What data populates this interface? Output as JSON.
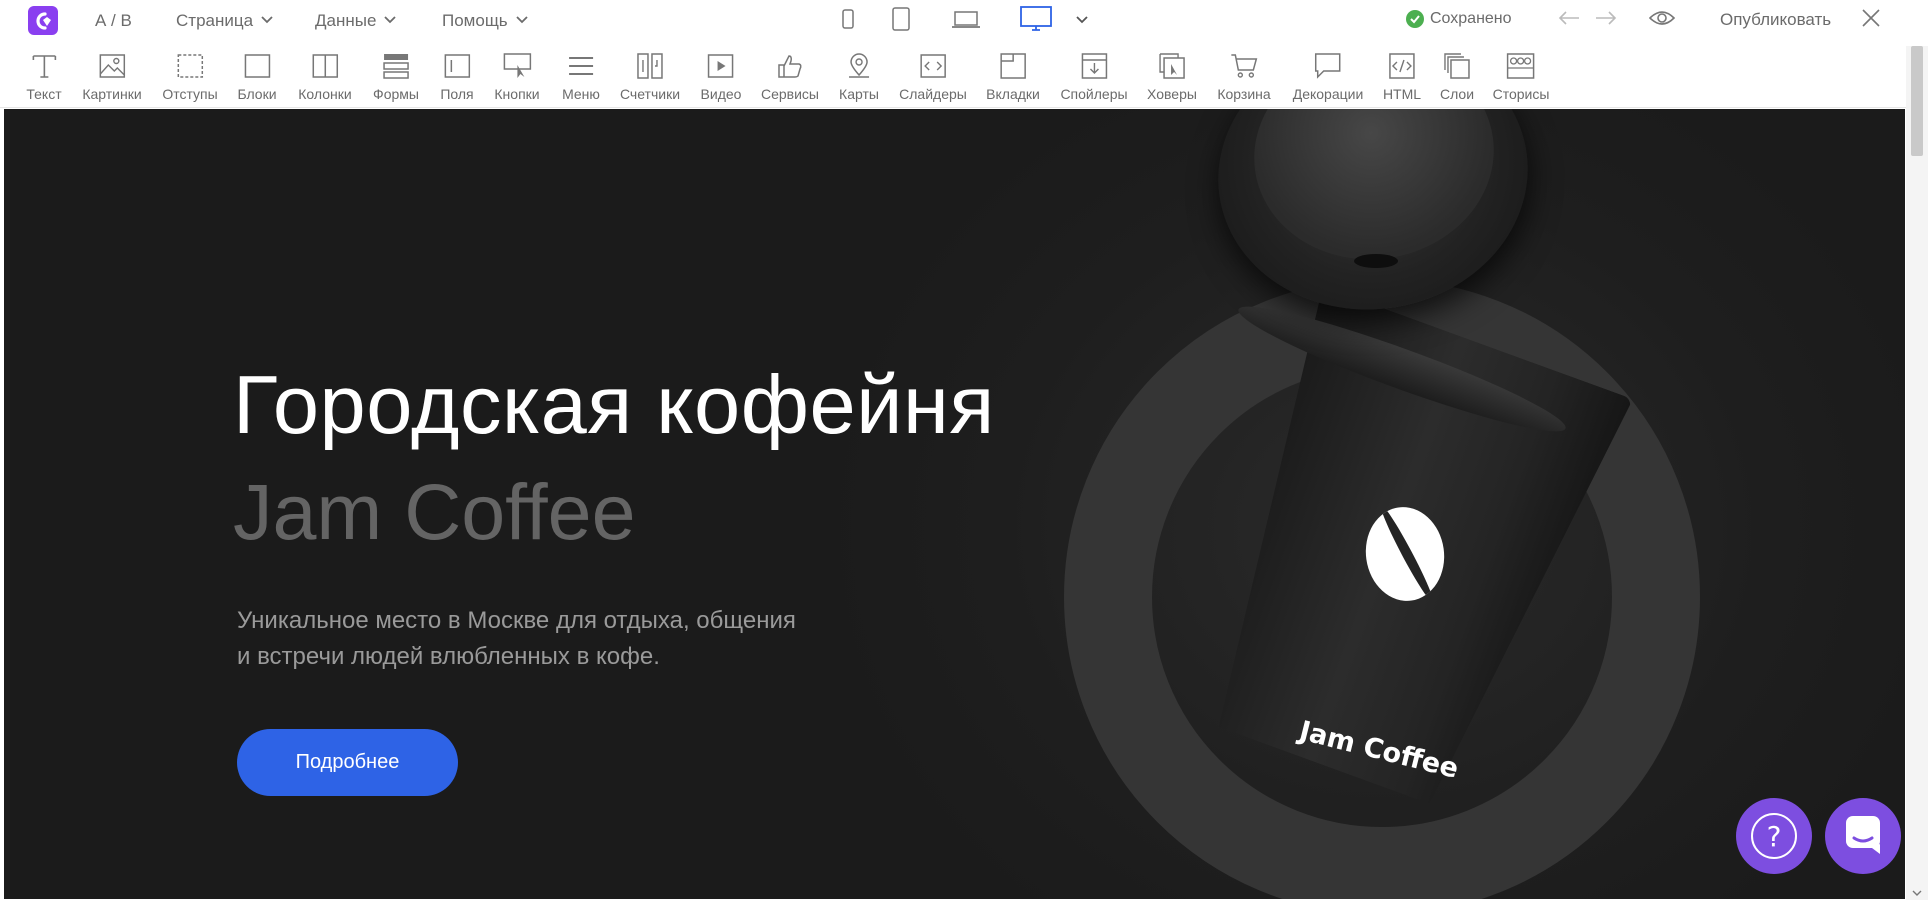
{
  "topbar": {
    "ab_label": "А / В",
    "menus": [
      {
        "label": "Страница"
      },
      {
        "label": "Данные"
      },
      {
        "label": "Помощь"
      }
    ],
    "devices": [
      "mobile-icon",
      "tablet-icon",
      "laptop-icon",
      "desktop-icon"
    ],
    "active_device": "desktop-icon",
    "saved_label": "Сохранено",
    "publish_label": "Опубликовать"
  },
  "toolbar": {
    "items": [
      {
        "label": "Текст",
        "icon": "text-icon"
      },
      {
        "label": "Картинки",
        "icon": "image-icon"
      },
      {
        "label": "Отступы",
        "icon": "spacing-icon"
      },
      {
        "label": "Блоки",
        "icon": "block-icon"
      },
      {
        "label": "Колонки",
        "icon": "columns-icon"
      },
      {
        "label": "Формы",
        "icon": "forms-icon"
      },
      {
        "label": "Поля",
        "icon": "fields-icon"
      },
      {
        "label": "Кнопки",
        "icon": "button-icon"
      },
      {
        "label": "Меню",
        "icon": "menu-icon"
      },
      {
        "label": "Счетчики",
        "icon": "counters-icon"
      },
      {
        "label": "Видео",
        "icon": "video-icon"
      },
      {
        "label": "Сервисы",
        "icon": "services-icon"
      },
      {
        "label": "Карты",
        "icon": "map-pin-icon"
      },
      {
        "label": "Слайдеры",
        "icon": "slider-icon"
      },
      {
        "label": "Вкладки",
        "icon": "tabs-icon"
      },
      {
        "label": "Спойлеры",
        "icon": "spoiler-icon"
      },
      {
        "label": "Ховеры",
        "icon": "hover-icon"
      },
      {
        "label": "Корзина",
        "icon": "cart-icon"
      },
      {
        "label": "Декорации",
        "icon": "decor-icon"
      },
      {
        "label": "HTML",
        "icon": "html-icon"
      },
      {
        "label": "Слои",
        "icon": "layers-icon"
      },
      {
        "label": "Сторисы",
        "icon": "stories-icon"
      }
    ]
  },
  "hero": {
    "title": "Городская кофейня",
    "subtitle": "Jam Coffee",
    "lead_line1": "Уникальное место в Москве для отдыха, общения",
    "lead_line2": "и встречи людей влюбленных в кофе.",
    "cta_label": "Подробнее",
    "cup_brand": "Jam Coffee"
  },
  "floating": {
    "help_label": "?"
  },
  "colors": {
    "accent": "#8a3ff0",
    "cta": "#2e63e6",
    "fab": "#7d4ee0",
    "canvas_bg": "#1b1b1b",
    "saved_check": "#4caf50"
  }
}
